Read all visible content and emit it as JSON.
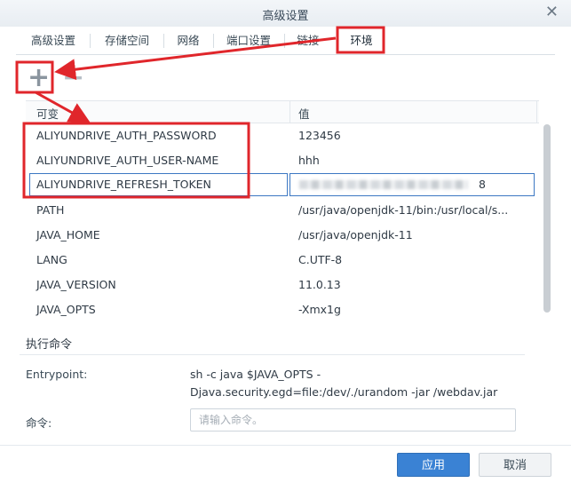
{
  "window": {
    "title": "高级设置",
    "close_glyph": "✕"
  },
  "tabs": [
    {
      "label": "高级设置",
      "active": false
    },
    {
      "label": "存储空间",
      "active": false
    },
    {
      "label": "网络",
      "active": false
    },
    {
      "label": "端口设置",
      "active": false
    },
    {
      "label": "链接",
      "active": false
    },
    {
      "label": "环境",
      "active": true
    }
  ],
  "toolbar": {
    "add_glyph": "+",
    "remove_glyph": "−"
  },
  "table": {
    "columns": [
      "可变",
      "值"
    ],
    "rows": [
      {
        "name": "ALIYUNDRIVE_AUTH_PASSWORD",
        "value": "123456"
      },
      {
        "name": "ALIYUNDRIVE_AUTH_USER-NAME",
        "value": "hhh"
      },
      {
        "name": "ALIYUNDRIVE_REFRESH_TOKEN",
        "value": "8"
      },
      {
        "name": "PATH",
        "value": "/usr/java/openjdk-11/bin:/usr/local/s..."
      },
      {
        "name": "JAVA_HOME",
        "value": "/usr/java/openjdk-11"
      },
      {
        "name": "LANG",
        "value": "C.UTF-8"
      },
      {
        "name": "JAVA_VERSION",
        "value": "11.0.13"
      },
      {
        "name": "JAVA_OPTS",
        "value": "-Xmx1g"
      }
    ]
  },
  "exec": {
    "section_title": "执行命令",
    "entrypoint_label": "Entrypoint:",
    "entrypoint_value": "sh -c java $JAVA_OPTS -Djava.security.egd=file:/dev/./urandom -jar /webdav.jar",
    "command_label": "命令:",
    "command_value": "",
    "command_placeholder": "请输入命令。"
  },
  "footer": {
    "apply_label": "应用",
    "cancel_label": "取消"
  },
  "colors": {
    "accent": "#3a82d4",
    "annotation": "#e0262b"
  },
  "icons": [
    "close-icon",
    "add-icon",
    "remove-icon"
  ]
}
